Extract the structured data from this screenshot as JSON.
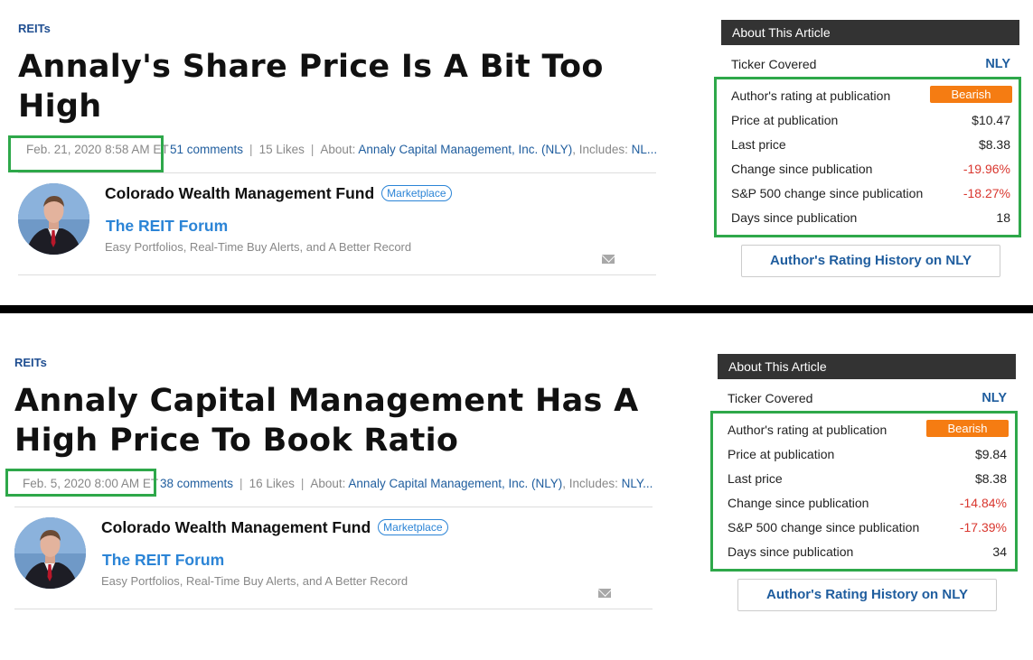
{
  "articles": [
    {
      "category": "REITs",
      "title": "Annaly's Share Price Is A Bit Too High",
      "date": "Feb. 21, 2020 8:58 AM ET",
      "comments": "51 comments",
      "likes": "15 Likes",
      "about_label": "About:",
      "about_link": "Annaly Capital Management, Inc. (NLY)",
      "includes_label": ", Includes:",
      "includes_value": "NL...",
      "author_name": "Colorado Wealth Management Fund",
      "badge": "Marketplace",
      "service": "The REIT Forum",
      "tagline": "Easy Portfolios, Real-Time Buy Alerts, and A Better Record",
      "sidebar": {
        "header": "About This Article",
        "ticker_label": "Ticker Covered",
        "ticker": "NLY",
        "rating_label": "Author's rating at publication",
        "rating": "Bearish",
        "rows": [
          {
            "label": "Price at publication",
            "value": "$10.47"
          },
          {
            "label": "Last price",
            "value": "$8.38"
          },
          {
            "label": "Change since publication",
            "value": "-19.96%"
          },
          {
            "label": "S&P 500 change since publication",
            "value": "-18.27%"
          },
          {
            "label": "Days since publication",
            "value": "18"
          }
        ],
        "history_button": "Author's Rating History on NLY"
      }
    },
    {
      "category": "REITs",
      "title": "Annaly Capital Management Has A High Price To Book Ratio",
      "date": "Feb. 5, 2020 8:00 AM ET",
      "comments": "38 comments",
      "likes": "16 Likes",
      "about_label": "About:",
      "about_link": "Annaly Capital Management, Inc. (NLY)",
      "includes_label": ", Includes:",
      "includes_value": "NLY....",
      "author_name": "Colorado Wealth Management Fund",
      "badge": "Marketplace",
      "service": "The REIT Forum",
      "tagline": "Easy Portfolios, Real-Time Buy Alerts, and A Better Record",
      "sidebar": {
        "header": "About This Article",
        "ticker_label": "Ticker Covered",
        "ticker": "NLY",
        "rating_label": "Author's rating at publication",
        "rating": "Bearish",
        "rows": [
          {
            "label": "Price at publication",
            "value": "$9.84"
          },
          {
            "label": "Last price",
            "value": "$8.38"
          },
          {
            "label": "Change since publication",
            "value": "-14.84%"
          },
          {
            "label": "S&P 500 change since publication",
            "value": "-17.39%"
          },
          {
            "label": "Days since publication",
            "value": "34"
          }
        ],
        "history_button": "Author's Rating History on NLY"
      }
    }
  ],
  "colors": {
    "highlight_box": "#2ea84a",
    "bearish": "#f57c12",
    "negative": "#d9372f",
    "link": "#1f5d9e",
    "brand_blue": "#2b84d6"
  },
  "icons": [
    "avatar",
    "mail-icon"
  ]
}
